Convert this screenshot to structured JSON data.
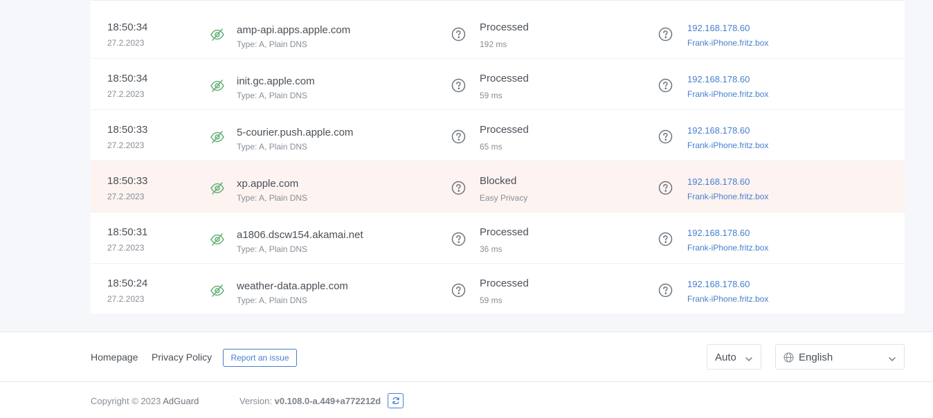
{
  "log": {
    "rows": [
      {
        "time": "18:50:34",
        "date": "27.2.2023",
        "domain": "amp-api.apps.apple.com",
        "type": "Type: A, Plain DNS",
        "status": "Processed",
        "detail": "192 ms",
        "ip": "192.168.178.60",
        "client": "Frank-iPhone.fritz.box",
        "blocked": false
      },
      {
        "time": "18:50:34",
        "date": "27.2.2023",
        "domain": "init.gc.apple.com",
        "type": "Type: A, Plain DNS",
        "status": "Processed",
        "detail": "59 ms",
        "ip": "192.168.178.60",
        "client": "Frank-iPhone.fritz.box",
        "blocked": false
      },
      {
        "time": "18:50:33",
        "date": "27.2.2023",
        "domain": "5-courier.push.apple.com",
        "type": "Type: A, Plain DNS",
        "status": "Processed",
        "detail": "65 ms",
        "ip": "192.168.178.60",
        "client": "Frank-iPhone.fritz.box",
        "blocked": false
      },
      {
        "time": "18:50:33",
        "date": "27.2.2023",
        "domain": "xp.apple.com",
        "type": "Type: A, Plain DNS",
        "status": "Blocked",
        "detail": "Easy Privacy",
        "ip": "192.168.178.60",
        "client": "Frank-iPhone.fritz.box",
        "blocked": true
      },
      {
        "time": "18:50:31",
        "date": "27.2.2023",
        "domain": "a1806.dscw154.akamai.net",
        "type": "Type: A, Plain DNS",
        "status": "Processed",
        "detail": "36 ms",
        "ip": "192.168.178.60",
        "client": "Frank-iPhone.fritz.box",
        "blocked": false
      },
      {
        "time": "18:50:24",
        "date": "27.2.2023",
        "domain": "weather-data.apple.com",
        "type": "Type: A, Plain DNS",
        "status": "Processed",
        "detail": "59 ms",
        "ip": "192.168.178.60",
        "client": "Frank-iPhone.fritz.box",
        "blocked": false
      }
    ],
    "icons": {
      "row_status": "eye-slash-icon",
      "info": "question-circle-icon"
    }
  },
  "footer": {
    "homepage_label": "Homepage",
    "privacy_label": "Privacy Policy",
    "report_label": "Report an issue",
    "theme_select": "Auto",
    "language_select": "English",
    "copyright_prefix": "Copyright © 2023",
    "copyright_brand": "AdGuard",
    "version_label": "Version:",
    "version_value": "v0.108.0-a.449+a772212d"
  },
  "colors": {
    "accent": "#467fcf",
    "eye_icon": "#67b279",
    "blocked_row_bg": "#fdf3f1"
  }
}
